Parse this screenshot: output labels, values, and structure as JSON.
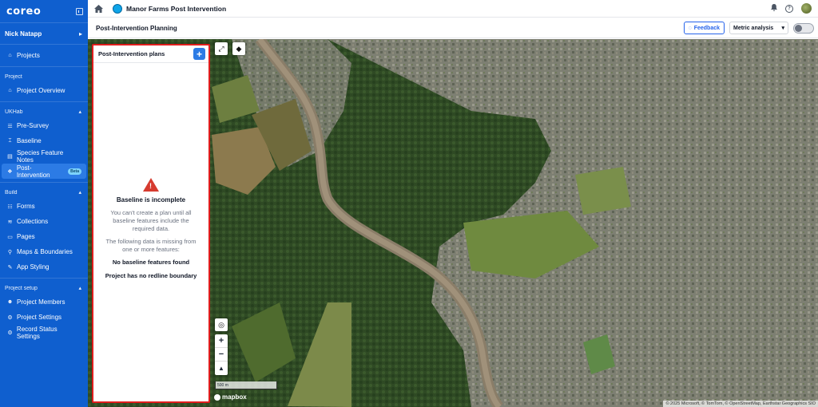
{
  "sidebar": {
    "logo": "coreo",
    "user_name": "Nick Natapp",
    "top_items": [
      {
        "label": "Projects",
        "icon": "home-icon"
      }
    ],
    "sections": [
      {
        "title": "Project",
        "items": [
          {
            "label": "Project Overview",
            "icon": "home-icon"
          }
        ]
      },
      {
        "title": "UKHab",
        "items": [
          {
            "label": "Pre-Survey",
            "icon": "list-icon"
          },
          {
            "label": "Baseline",
            "icon": "baseline-icon"
          },
          {
            "label": "Species Feature Notes",
            "icon": "notes-icon"
          },
          {
            "label": "Post-Intervention",
            "icon": "post-intervention-icon",
            "badge": "Beta",
            "active": true
          }
        ]
      },
      {
        "title": "Build",
        "items": [
          {
            "label": "Forms",
            "icon": "forms-icon"
          },
          {
            "label": "Collections",
            "icon": "collections-icon"
          },
          {
            "label": "Pages",
            "icon": "pages-icon"
          },
          {
            "label": "Maps & Boundaries",
            "icon": "map-pin-icon"
          },
          {
            "label": "App Styling",
            "icon": "paint-icon"
          }
        ]
      },
      {
        "title": "Project setup",
        "items": [
          {
            "label": "Project Members",
            "icon": "members-icon"
          },
          {
            "label": "Project Settings",
            "icon": "gear-icon"
          },
          {
            "label": "Record Status Settings",
            "icon": "status-gear-icon"
          }
        ]
      }
    ]
  },
  "topbar": {
    "project_title": "Manor Farms Post Intervention"
  },
  "subbar": {
    "page_title": "Post-Intervention Planning",
    "feedback_label": "Feedback",
    "metric_select": "Metric analysis"
  },
  "panel": {
    "title": "Post-Intervention plans",
    "add_label": "+",
    "empty_title": "Baseline is incomplete",
    "empty_text": "You can't create a plan until all baseline features include the required data.",
    "missing_intro": "The following data is missing from one or more features:",
    "missing_items": [
      "No baseline features found",
      "Project has no redline boundary"
    ]
  },
  "map": {
    "scale_label": "500 m",
    "brand": "mapbox",
    "attribution": "© 2025 Microsoft, © TomTom, © OpenStreetMap, Earthstar Geographics SIO"
  },
  "colors": {
    "sidebar": "#0f5fcf",
    "accent": "#2c7be5",
    "warning": "#d63b2f",
    "panel_border": "#e11d1d"
  }
}
